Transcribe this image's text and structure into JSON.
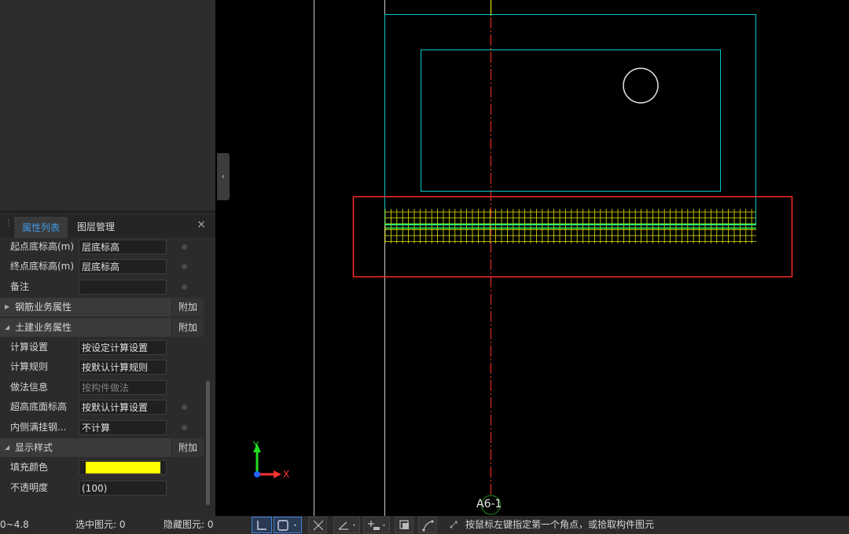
{
  "panel": {
    "tabs": [
      {
        "label": "属性列表",
        "active": true
      },
      {
        "label": "图层管理",
        "active": false
      }
    ],
    "close_glyph": "×",
    "rows_top": [
      {
        "label": "起点底标高(m)",
        "value": "层底标高"
      },
      {
        "label": "终点底标高(m)",
        "value": "层底标高"
      },
      {
        "label": "备注",
        "value": ""
      }
    ],
    "groups": {
      "rebar": {
        "label": "钢筋业务属性",
        "add": "附加",
        "expanded": false
      },
      "civil": {
        "label": "土建业务属性",
        "add": "附加",
        "expanded": true
      },
      "display": {
        "label": "显示样式",
        "add": "附加",
        "expanded": true
      }
    },
    "rows_civil": [
      {
        "label": "计算设置",
        "value": "按设定计算设置"
      },
      {
        "label": "计算规则",
        "value": "按默认计算规则"
      },
      {
        "label": "做法信息",
        "value": "按构件做法",
        "placeholder": true
      },
      {
        "label": "超高底面标高",
        "value": "按默认计算设置"
      },
      {
        "label": "内侧满挂钢...",
        "value": "不计算"
      }
    ],
    "rows_display": [
      {
        "label": "填充颜色",
        "value": "",
        "color": "#ffff00"
      },
      {
        "label": "不透明度",
        "value": "(100)"
      }
    ]
  },
  "canvas": {
    "axis_label": "A6-1",
    "ucs": {
      "x_label": "X",
      "y_label": "Y"
    },
    "colors": {
      "outline": "#00c8c8",
      "grid": "#e6e600",
      "selection": "#ff2a2a",
      "axis": "#ff3030"
    }
  },
  "status": {
    "elevation": "0~4.8",
    "selected_label": "选中图元: 0",
    "hidden_label": "隐藏图元: 0",
    "hint": "按鼠标左键指定第一个角点，或拾取构件图元"
  }
}
